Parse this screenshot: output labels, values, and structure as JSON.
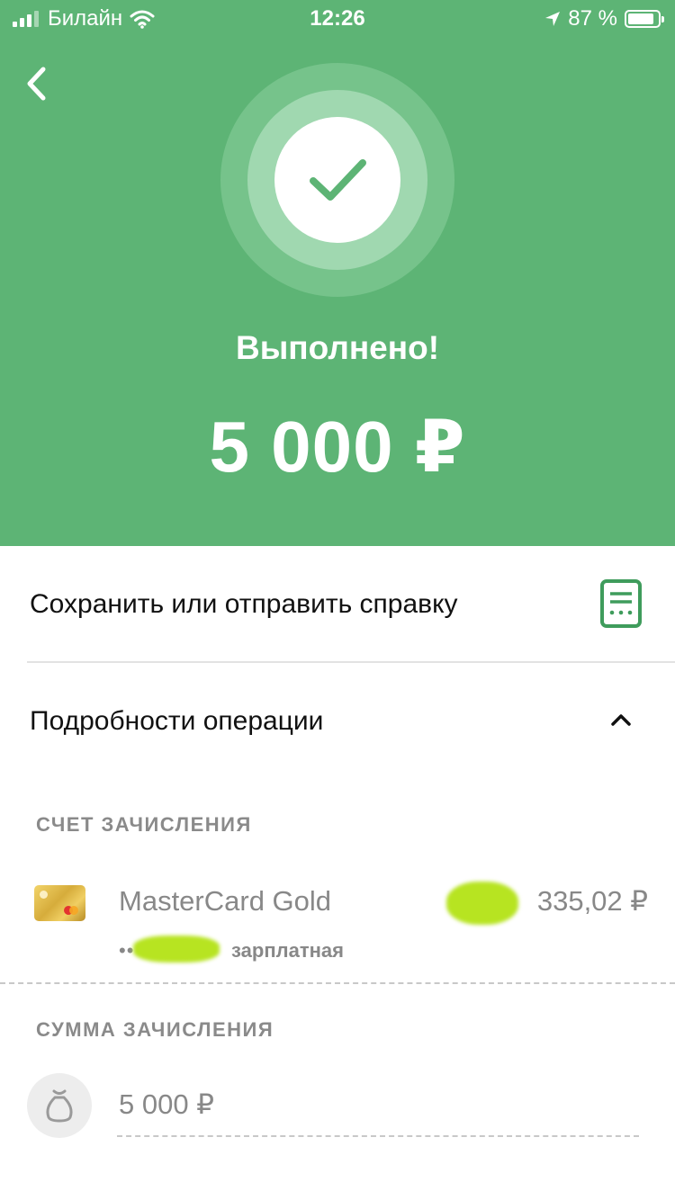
{
  "status_bar": {
    "carrier": "Билайн",
    "time": "12:26",
    "battery_percent": "87 %",
    "battery_level": 0.87
  },
  "header": {
    "back_icon": "chevron-left-icon",
    "success_icon": "checkmark-icon",
    "title": "Выполнено!",
    "amount": "5 000 ₽",
    "background_color": "#5db475"
  },
  "actions": {
    "save_label": "Сохранить или отправить справку",
    "save_icon": "document-receipt-icon",
    "details_label": "Подробности операции",
    "details_icon": "chevron-up-icon"
  },
  "credit_account": {
    "section_label": "СЧЕТ ЗАЧИСЛЕНИЯ",
    "card_name": "MasterCard Gold",
    "card_number_masked": "••",
    "card_type": "зарплатная",
    "balance": "335,02 ₽"
  },
  "credit_amount": {
    "section_label": "СУММА ЗАЧИСЛЕНИЯ",
    "value": "5 000 ₽",
    "icon": "money-bag-icon"
  }
}
